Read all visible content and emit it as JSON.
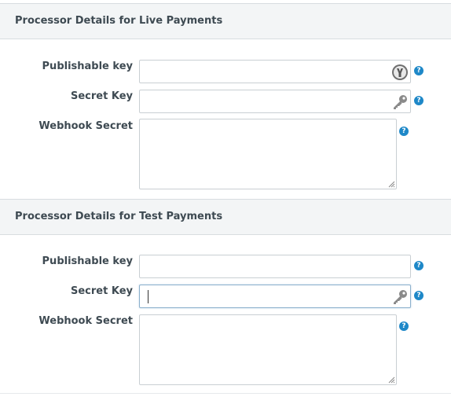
{
  "live": {
    "title": "Processor Details for Live Payments",
    "publishable_key_label": "Publishable key",
    "publishable_key_value": "",
    "secret_key_label": "Secret Key",
    "secret_key_value": "",
    "webhook_secret_label": "Webhook Secret",
    "webhook_secret_value": ""
  },
  "test": {
    "title": "Processor Details for Test Payments",
    "publishable_key_label": "Publishable key",
    "publishable_key_value": "",
    "secret_key_label": "Secret Key",
    "secret_key_value": "",
    "webhook_secret_label": "Webhook Secret",
    "webhook_secret_value": ""
  },
  "help_glyph": "?",
  "colors": {
    "help_icon": "#1e88c8",
    "header_bg": "#f3f5f6"
  }
}
